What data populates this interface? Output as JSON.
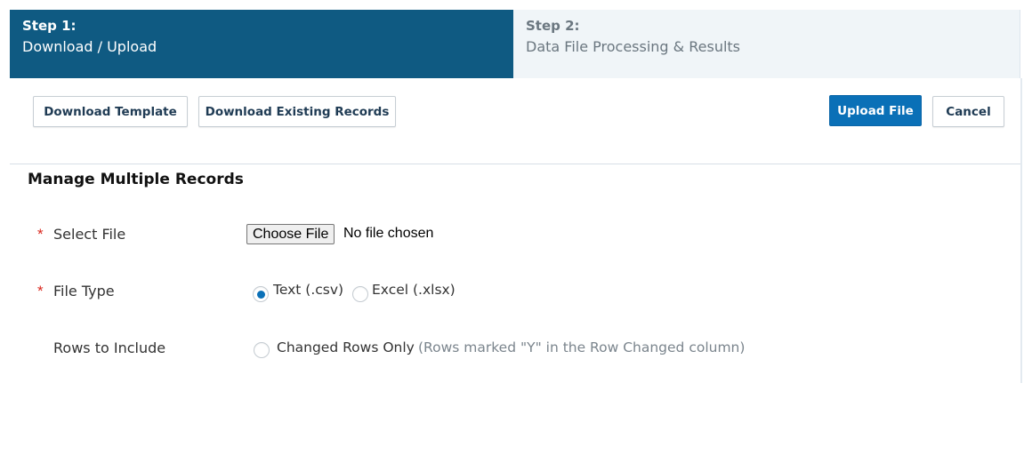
{
  "steps": [
    {
      "number": "Step 1:",
      "description": "Download / Upload",
      "active": true
    },
    {
      "number": "Step 2:",
      "description": "Data File Processing & Results",
      "active": false
    }
  ],
  "toolbar": {
    "download_template_label": "Download Template",
    "download_existing_label": "Download Existing Records",
    "upload_label": "Upload File",
    "cancel_label": "Cancel"
  },
  "section": {
    "title": "Manage Multiple Records"
  },
  "form": {
    "required_marker": "*",
    "select_file": {
      "label": "Select File",
      "required": true,
      "button_label": "Choose File",
      "status": "No file chosen"
    },
    "file_type": {
      "label": "File Type",
      "required": true,
      "options": [
        {
          "label": "Text (.csv)",
          "checked": true
        },
        {
          "label": "Excel (.xlsx)",
          "checked": false
        }
      ]
    },
    "rows_to_include": {
      "label": "Rows to Include",
      "required": false,
      "option_label": "Changed Rows Only",
      "option_checked": false,
      "hint": "(Rows marked \"Y\" in the Row Changed column)"
    }
  },
  "colors": {
    "active_step_bg": "#0f5a82",
    "inactive_step_bg": "#f0f5f8",
    "primary_button": "#0a70b7",
    "required_marker": "#d9261c"
  }
}
